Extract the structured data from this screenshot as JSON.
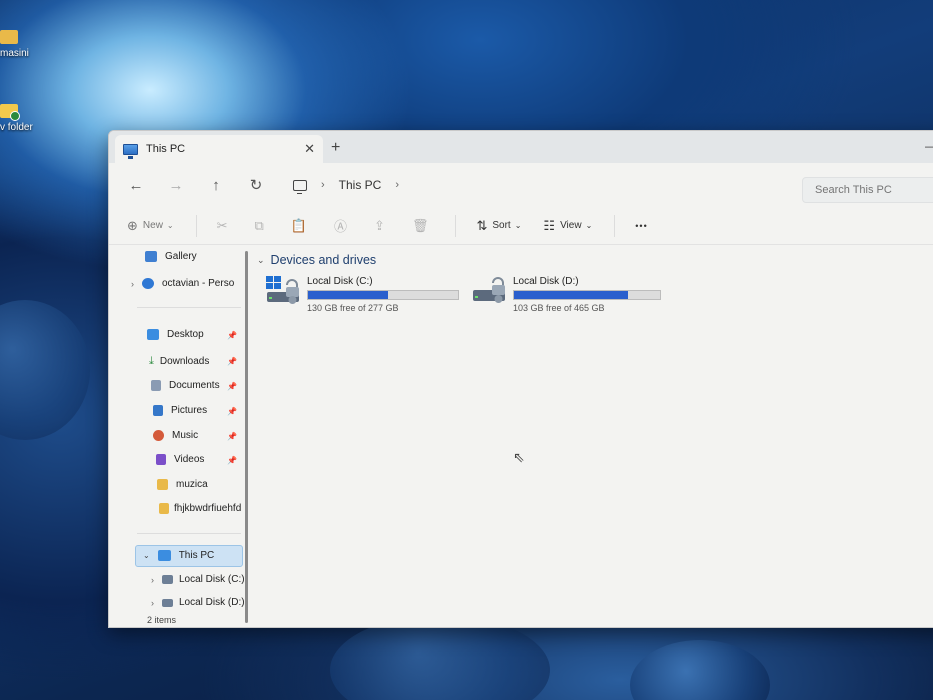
{
  "desktop": {
    "icons": [
      {
        "label": "masini"
      },
      {
        "label": "v folder"
      }
    ]
  },
  "window": {
    "tab_title": "This PC",
    "tab_close_glyph": "✕",
    "new_tab_glyph": "+",
    "minimize_glyph": "—"
  },
  "nav": {
    "back_glyph": "←",
    "forward_glyph": "→",
    "up_glyph": "↑",
    "refresh_glyph": "↻",
    "breadcrumb": [
      "This PC"
    ],
    "breadcrumb_sep": "›"
  },
  "search": {
    "placeholder": "Search This PC"
  },
  "toolbar": {
    "new_label": "New",
    "sort_label": "Sort",
    "view_label": "View",
    "more_glyph": "•••",
    "dropdown_glyph": "⌄"
  },
  "sidebar": {
    "top_items": [
      {
        "label": "Gallery",
        "icon": "gallery-icon"
      },
      {
        "label": "octavian - Perso",
        "icon": "onedrive-icon"
      }
    ],
    "quick_access": [
      {
        "label": "Desktop",
        "icon": "desktop-icon",
        "pinned": true
      },
      {
        "label": "Downloads",
        "icon": "download-icon",
        "pinned": true
      },
      {
        "label": "Documents",
        "icon": "documents-icon",
        "pinned": true
      },
      {
        "label": "Pictures",
        "icon": "pictures-icon",
        "pinned": true
      },
      {
        "label": "Music",
        "icon": "music-icon",
        "pinned": true
      },
      {
        "label": "Videos",
        "icon": "videos-icon",
        "pinned": true
      },
      {
        "label": "muzica",
        "icon": "folder-icon",
        "pinned": false
      },
      {
        "label": "fhjkbwdrfiuehfd",
        "icon": "folder-icon",
        "pinned": false
      }
    ],
    "this_pc": {
      "label": "This PC",
      "children": [
        {
          "label": "Local Disk (C:)"
        },
        {
          "label": "Local Disk (D:)"
        }
      ]
    },
    "pin_glyph": "📌"
  },
  "main": {
    "group_title": "Devices and drives",
    "drives": [
      {
        "name": "Local Disk (C:)",
        "free_text": "130 GB free of 277 GB",
        "used_fraction": 0.53,
        "system": true
      },
      {
        "name": "Local Disk (D:)",
        "free_text": "103 GB free of 465 GB",
        "used_fraction": 0.78,
        "system": false
      }
    ]
  },
  "status": {
    "item_count": "2 items"
  },
  "colors": {
    "accent": "#2a5fcd",
    "selection": "#cde2f4"
  }
}
